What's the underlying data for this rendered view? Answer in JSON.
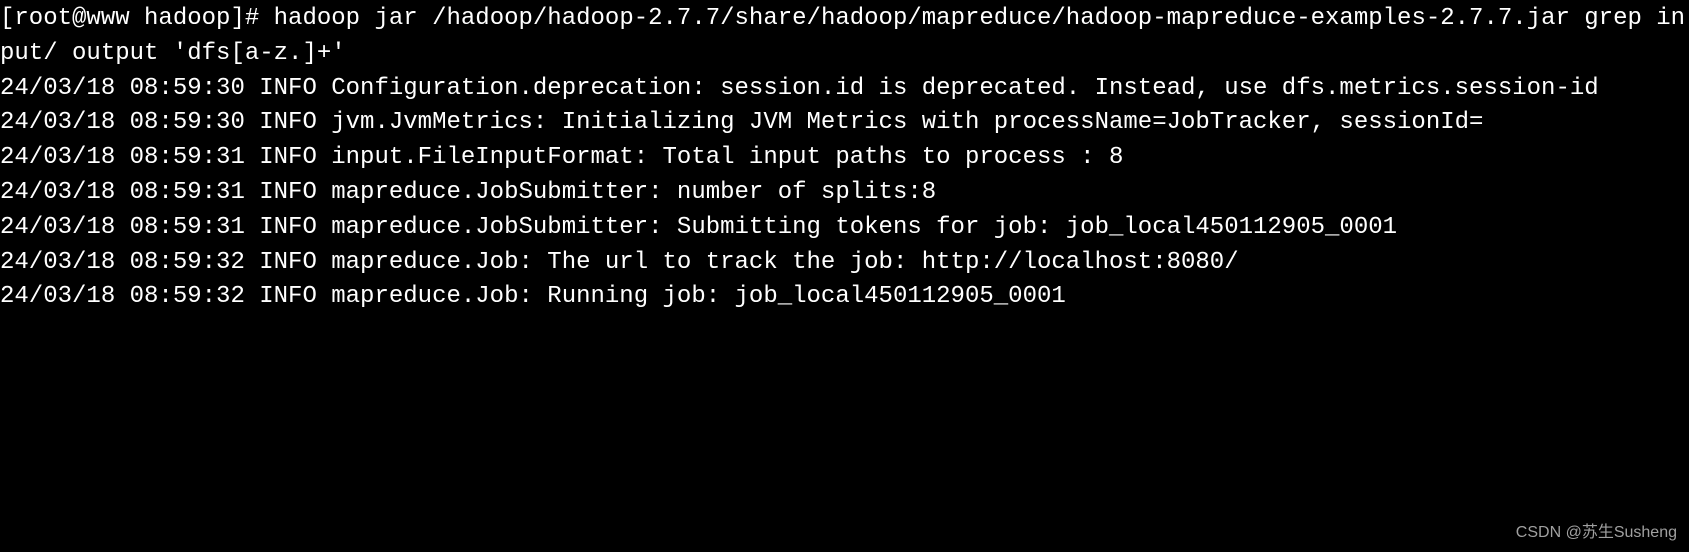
{
  "terminal": {
    "prompt": "[root@www hadoop]# ",
    "command": "hadoop jar /hadoop/hadoop-2.7.7/share/hadoop/mapreduce/hadoop-mapreduce-examples-2.7.7.jar grep input/ output 'dfs[a-z.]+'",
    "lines": [
      "24/03/18 08:59:30 INFO Configuration.deprecation: session.id is deprecated. Instead, use dfs.metrics.session-id",
      "24/03/18 08:59:30 INFO jvm.JvmMetrics: Initializing JVM Metrics with processName=JobTracker, sessionId=",
      "24/03/18 08:59:31 INFO input.FileInputFormat: Total input paths to process : 8",
      "24/03/18 08:59:31 INFO mapreduce.JobSubmitter: number of splits:8",
      "24/03/18 08:59:31 INFO mapreduce.JobSubmitter: Submitting tokens for job: job_local450112905_0001",
      "24/03/18 08:59:32 INFO mapreduce.Job: The url to track the job: http://localhost:8080/",
      "24/03/18 08:59:32 INFO mapreduce.Job: Running job: job_local450112905_0001"
    ]
  },
  "watermark": {
    "text": "CSDN @苏生Susheng"
  }
}
